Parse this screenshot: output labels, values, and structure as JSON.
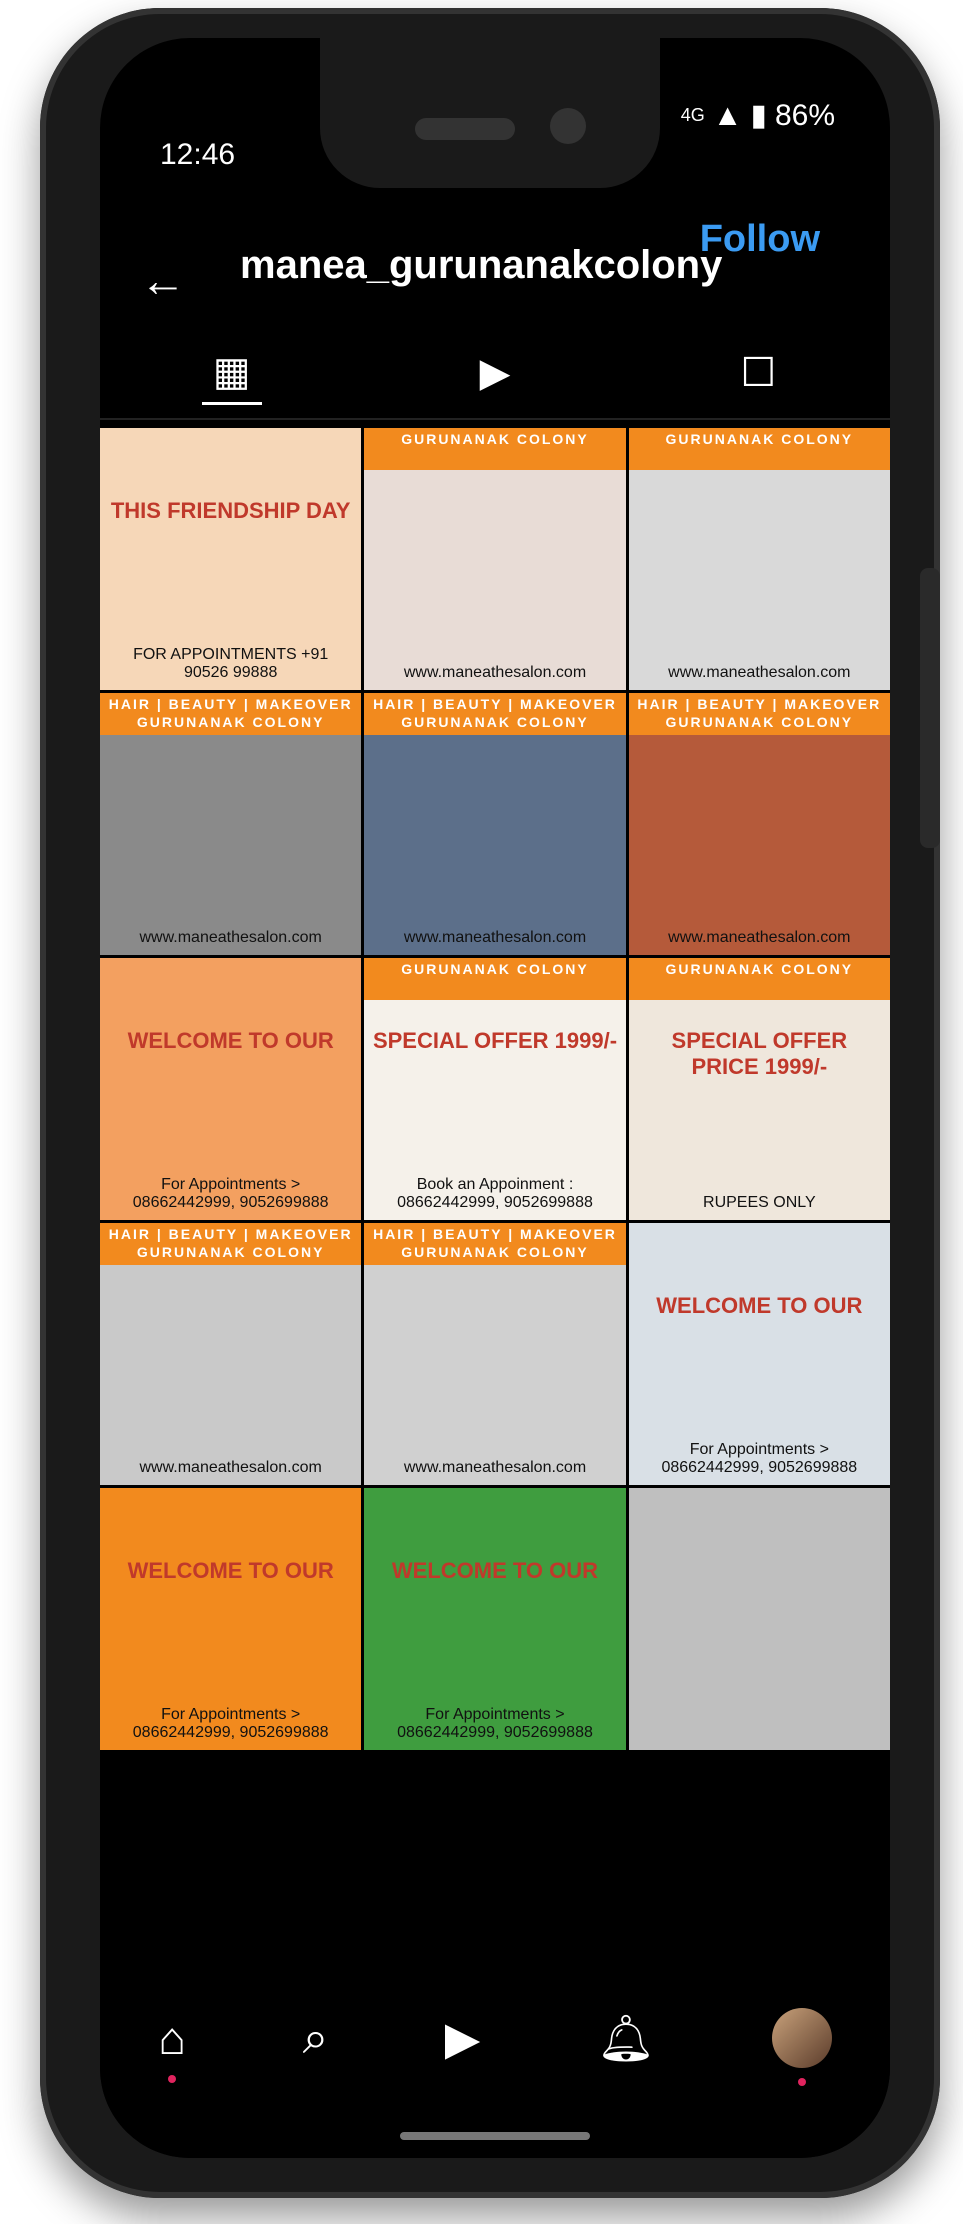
{
  "status": {
    "time": "12:46",
    "network": "4G",
    "battery": "86%"
  },
  "header": {
    "username": "manea_gurunanakcolony",
    "follow_label": "Follow"
  },
  "tabs": [
    "grid",
    "reels",
    "tagged"
  ],
  "grid": [
    {
      "band": "",
      "body": "THIS FRIENDSHIP DAY",
      "caption": "FOR APPOINTMENTS +91 90526 99888"
    },
    {
      "band": "GURUNANAK COLONY",
      "body": "",
      "caption": "www.maneathesalon.com"
    },
    {
      "band": "GURUNANAK COLONY",
      "body": "",
      "caption": "www.maneathesalon.com"
    },
    {
      "band": "HAIR | BEAUTY | MAKEOVER GURUNANAK COLONY",
      "body": "",
      "caption": "www.maneathesalon.com"
    },
    {
      "band": "HAIR | BEAUTY | MAKEOVER GURUNANAK COLONY",
      "body": "",
      "caption": "www.maneathesalon.com"
    },
    {
      "band": "HAIR | BEAUTY | MAKEOVER GURUNANAK COLONY",
      "body": "",
      "caption": "www.maneathesalon.com"
    },
    {
      "band": "",
      "body": "WELCOME TO OUR",
      "caption": "For Appointments > 08662442999, 9052699888"
    },
    {
      "band": "GURUNANAK COLONY",
      "body": "SPECIAL OFFER 1999/-",
      "caption": "Book an Appoinment : 08662442999, 9052699888"
    },
    {
      "band": "GURUNANAK COLONY",
      "body": "SPECIAL OFFER PRICE 1999/-",
      "caption": "RUPEES ONLY"
    },
    {
      "band": "HAIR | BEAUTY | MAKEOVER GURUNANAK COLONY",
      "body": "",
      "caption": "www.maneathesalon.com"
    },
    {
      "band": "HAIR | BEAUTY | MAKEOVER GURUNANAK COLONY",
      "body": "",
      "caption": "www.maneathesalon.com"
    },
    {
      "band": "",
      "body": "WELCOME TO OUR",
      "caption": "For Appointments > 08662442999, 9052699888"
    },
    {
      "band": "",
      "body": "WELCOME TO OUR",
      "caption": "For Appointments > 08662442999, 9052699888"
    },
    {
      "band": "",
      "body": "WELCOME TO OUR",
      "caption": "For Appointments > 08662442999, 9052699888"
    },
    {
      "band": "",
      "body": "",
      "caption": ""
    }
  ],
  "colors": {
    "accent": "#f28a1e",
    "follow": "#3b9bf2",
    "background": "#000000"
  },
  "bottom_nav": [
    "home-icon",
    "search-icon",
    "reels-icon",
    "notifications-icon",
    "profile-avatar"
  ]
}
